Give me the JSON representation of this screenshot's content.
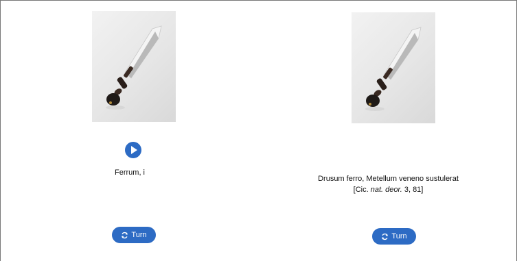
{
  "front": {
    "term": "Ferrum, i",
    "image_icon": "dagger-image",
    "play_icon": "play-icon",
    "turn_label": "Turn"
  },
  "back": {
    "quote_line1": "Drusum ferro, Metellum veneno sustulerat",
    "citation_prefix": "[Cic. ",
    "citation_italic": "nat. deor.",
    "citation_suffix": " 3, 81]",
    "image_icon": "dagger-image",
    "turn_label": "Turn"
  },
  "colors": {
    "accent": "#2d6bc4",
    "border": "#777777"
  }
}
